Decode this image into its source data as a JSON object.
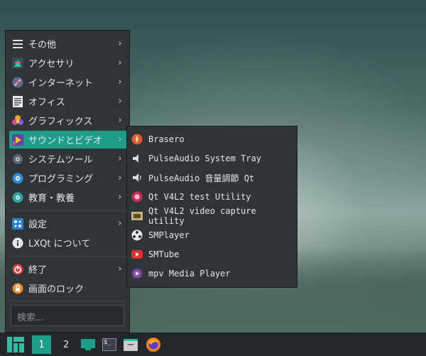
{
  "menu": {
    "items": [
      {
        "label": "その他",
        "icon": "other-icon",
        "submenu": true
      },
      {
        "label": "アクセサリ",
        "icon": "accessories-icon",
        "submenu": true
      },
      {
        "label": "インターネット",
        "icon": "internet-icon",
        "submenu": true
      },
      {
        "label": "オフィス",
        "icon": "office-icon",
        "submenu": true
      },
      {
        "label": "グラフィックス",
        "icon": "graphics-icon",
        "submenu": true
      },
      {
        "label": "サウンドとビデオ",
        "icon": "sound-video-icon",
        "submenu": true
      },
      {
        "label": "システムツール",
        "icon": "system-tools-icon",
        "submenu": true
      },
      {
        "label": "プログラミング",
        "icon": "programming-icon",
        "submenu": true
      },
      {
        "label": "教育・教養",
        "icon": "education-icon",
        "submenu": true
      },
      {
        "label": "設定",
        "icon": "settings-icon",
        "submenu": true
      },
      {
        "label": "LXQt について",
        "icon": "info-icon",
        "submenu": false
      },
      {
        "label": "終了",
        "icon": "power-icon",
        "submenu": true
      },
      {
        "label": "画面のロック",
        "icon": "lock-icon",
        "submenu": false
      }
    ],
    "search_placeholder": "検索...",
    "arrow": "›"
  },
  "submenu": {
    "items": [
      {
        "label": "Brasero",
        "icon": "brasero-icon"
      },
      {
        "label": "PulseAudio System Tray",
        "icon": "pulseaudio-tray-icon"
      },
      {
        "label": "PulseAudio 音量調節 Qt",
        "icon": "volume-icon"
      },
      {
        "label": "Qt V4L2 test Utility",
        "icon": "qv4l2-icon"
      },
      {
        "label": "Qt V4L2 video capture utility",
        "icon": "video-capture-icon"
      },
      {
        "label": "SMPlayer",
        "icon": "smplayer-icon"
      },
      {
        "label": "SMTube",
        "icon": "smtube-icon"
      },
      {
        "label": "mpv Media Player",
        "icon": "mpv-icon"
      }
    ]
  },
  "taskbar": {
    "workspace_1": "1",
    "workspace_2": "2",
    "terminal_glyph": "$_"
  },
  "colors": {
    "accent": "#1e9e8a",
    "menu_bg": "#2f3439",
    "panel_bg": "#23272b"
  }
}
